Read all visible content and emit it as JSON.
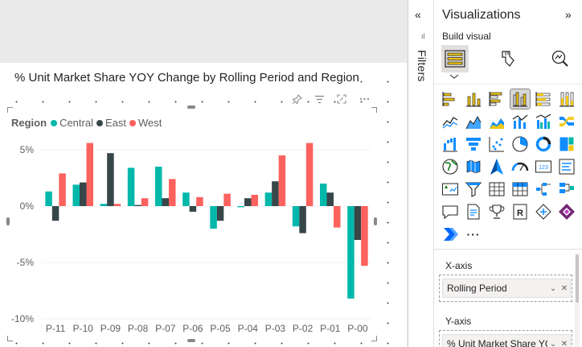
{
  "visual": {
    "title": "% Unit Market Share YOY Change by Rolling Period and Region",
    "legend": {
      "title": "Region",
      "items": [
        {
          "name": "Central",
          "color": "#01B8AA"
        },
        {
          "name": "East",
          "color": "#374649"
        },
        {
          "name": "West",
          "color": "#FD625E"
        }
      ]
    },
    "header_icons": [
      "pin-icon",
      "filter-icon",
      "focus-mode-icon",
      "more-options-icon"
    ]
  },
  "chart_data": {
    "type": "bar",
    "categories": [
      "P-11",
      "P-10",
      "P-09",
      "P-08",
      "P-07",
      "P-06",
      "P-05",
      "P-04",
      "P-03",
      "P-02",
      "P-01",
      "P-00"
    ],
    "ylim": [
      -10,
      6
    ],
    "yticks": [
      5,
      0,
      -5,
      -10
    ],
    "ytick_labels": [
      "5%",
      "0%",
      "-5%",
      "-10%"
    ],
    "grid": "horizontal",
    "legend_position": "top-left",
    "series": [
      {
        "name": "Central",
        "color": "#01B8AA",
        "values": [
          1.3,
          1.9,
          0.2,
          3.4,
          3.5,
          1.2,
          -2.0,
          -0.1,
          1.2,
          -1.8,
          2.0,
          -8.2
        ]
      },
      {
        "name": "East",
        "color": "#374649",
        "values": [
          -1.3,
          2.1,
          4.7,
          0.1,
          0.7,
          -0.5,
          -1.3,
          0.7,
          2.2,
          -2.4,
          1.2,
          -3.0
        ]
      },
      {
        "name": "West",
        "color": "#FD625E",
        "values": [
          2.9,
          5.6,
          0.2,
          0.7,
          2.4,
          0.8,
          1.1,
          1.0,
          4.5,
          5.6,
          -1.9,
          -5.3
        ]
      }
    ]
  },
  "filters": {
    "label": "Filters",
    "collapse_glyph": "«",
    "mini_glyph": "ıl"
  },
  "visualizations": {
    "title": "Visualizations",
    "expand_glyph": "»",
    "build_label": "Build visual",
    "modes": [
      "build-visual-icon",
      "format-visual-icon",
      "analytics-icon"
    ],
    "gallery": [
      "stacked-bar-chart-icon",
      "stacked-column-chart-icon",
      "clustered-bar-chart-icon",
      "clustered-column-chart-icon",
      "100-stacked-bar-chart-icon",
      "100-stacked-column-chart-icon",
      "line-chart-icon",
      "area-chart-icon",
      "stacked-area-chart-icon",
      "line-and-stacked-column-chart-icon",
      "line-and-clustered-column-chart-icon",
      "ribbon-chart-icon",
      "waterfall-chart-icon",
      "funnel-icon",
      "scatter-chart-icon",
      "pie-chart-icon",
      "donut-chart-icon",
      "treemap-icon",
      "map-icon",
      "filled-map-icon",
      "azure-map-icon",
      "gauge-icon",
      "card-icon",
      "multi-row-card-icon",
      "kpi-icon",
      "slicer-icon",
      "table-icon",
      "matrix-icon",
      "decomposition-tree-icon",
      "key-influencers-icon",
      "qa-icon",
      "paginated-report-icon",
      "goals-icon",
      "r-visual-icon",
      "python-visual-icon",
      "power-apps-icon",
      "power-automate-icon"
    ],
    "more_glyph": "···",
    "wells": [
      {
        "label": "X-axis",
        "field": "Rolling Period"
      },
      {
        "label": "Y-axis",
        "field": "% Unit Market Share YC"
      }
    ]
  }
}
